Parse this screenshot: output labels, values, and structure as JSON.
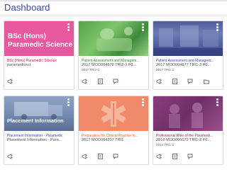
{
  "header": {
    "title": "Dashboard"
  },
  "cards": [
    {
      "title": "BSc (Hons) Paramedic Science",
      "subtitle": "paramedicsci",
      "meta": "",
      "image_text": "BSc (Hons)\nParamedic Science",
      "accent": "#c2185b"
    },
    {
      "title": "Patient Assessment and Managem...",
      "subtitle": "2017 MOD004878 TRI2-3 F0...",
      "meta": "2017 TRI2-3",
      "accent": "#3a9a3a"
    },
    {
      "title": "Patient Assessment and Managem...",
      "subtitle": "2017 MOD004877 TRI1-3 F0...",
      "meta": "2017 TRI1-3",
      "accent": "#3d4a9e"
    },
    {
      "title": "Placement Information - Paramedic",
      "subtitle": "Placement Information - Para...",
      "meta": "",
      "image_text": "Placement Information",
      "accent": "#3d4a9e"
    },
    {
      "title": "Preparation for Clinical Practice fo...",
      "subtitle": "2017 MOD004207 TRI1",
      "meta": "",
      "accent": "#e8623a"
    },
    {
      "title": "Professional Role of the Paramedi...",
      "subtitle": "2018 MOD006072 TRI1-2 F0...",
      "meta": "2018 TRI1-2",
      "accent": "#7b2c6c"
    }
  ],
  "icons": [
    "announcements-icon",
    "assignments-icon",
    "discussions-icon",
    "files-icon"
  ]
}
